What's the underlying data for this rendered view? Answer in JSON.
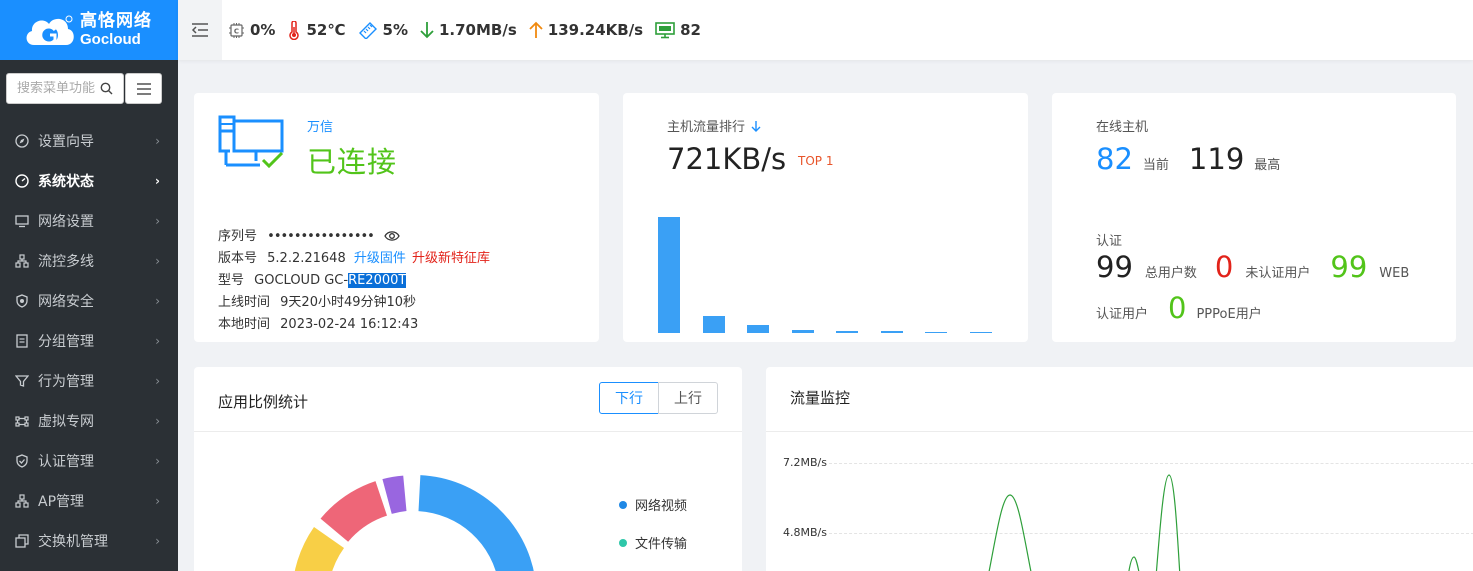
{
  "brand": {
    "name_cn": "高恪网络",
    "name_en": "Gocloud",
    "color": "#1a8fff"
  },
  "sidebar": {
    "search_placeholder": "搜索菜单功能",
    "items": [
      {
        "label": "设置向导",
        "icon": "compass-icon"
      },
      {
        "label": "系统状态",
        "icon": "gauge-icon",
        "active": true
      },
      {
        "label": "网络设置",
        "icon": "monitor-icon"
      },
      {
        "label": "流控多线",
        "icon": "network-icon"
      },
      {
        "label": "网络安全",
        "icon": "shield-icon"
      },
      {
        "label": "分组管理",
        "icon": "document-icon"
      },
      {
        "label": "行为管理",
        "icon": "filter-icon"
      },
      {
        "label": "虚拟专网",
        "icon": "vpn-icon"
      },
      {
        "label": "认证管理",
        "icon": "check-shield-icon"
      },
      {
        "label": "AP管理",
        "icon": "tree-icon"
      },
      {
        "label": "交换机管理",
        "icon": "switch-icon"
      }
    ]
  },
  "topbar": {
    "cpu": "0%",
    "temp": "52℃",
    "mem": "5%",
    "down": "1.70MB/s",
    "up": "139.24KB/s",
    "hosts": "82"
  },
  "device": {
    "vendor": "万信",
    "status": "已连接",
    "serial_label": "序列号",
    "serial": "••••••••••••••••",
    "version_label": "版本号",
    "version": "5.2.2.21648",
    "upgrade_firmware": "升级固件",
    "upgrade_signature": "升级新特征库",
    "model_label": "型号",
    "model_prefix": "GOCLOUD GC-",
    "model_selected": "RE2000T",
    "uptime_label": "上线时间",
    "uptime": "9天20小时49分钟10秒",
    "localtime_label": "本地时间",
    "localtime": "2023-02-24 16:12:43"
  },
  "traffic_rank": {
    "title": "主机流量排行",
    "value": "721KB/s",
    "badge": "TOP 1",
    "bar_levels": [
      1.0,
      0.15,
      0.07,
      0.03,
      0.015,
      0.015,
      0.01,
      0.01
    ]
  },
  "online": {
    "title": "在线主机",
    "current": "82",
    "current_label": "当前",
    "max": "119",
    "max_label": "最高",
    "auth_title": "认证",
    "total_users": "99",
    "total_users_label": "总用户数",
    "unauth": "0",
    "unauth_label": "未认证用户",
    "web": "99",
    "web_label": "WEB",
    "auth_users_label": "认证用户",
    "pppoe": "0",
    "pppoe_label": "PPPoE用户"
  },
  "app_stats": {
    "title": "应用比例统计",
    "tab_down": "下行",
    "tab_up": "上行",
    "legend": [
      {
        "name": "网络视频",
        "color": "#3aa0f5"
      },
      {
        "name": "文件传输",
        "color": "#2ec7c9"
      }
    ]
  },
  "monitor": {
    "title": "流量监控",
    "y_ticks": [
      "7.2MB/s",
      "4.8MB/s"
    ]
  }
}
